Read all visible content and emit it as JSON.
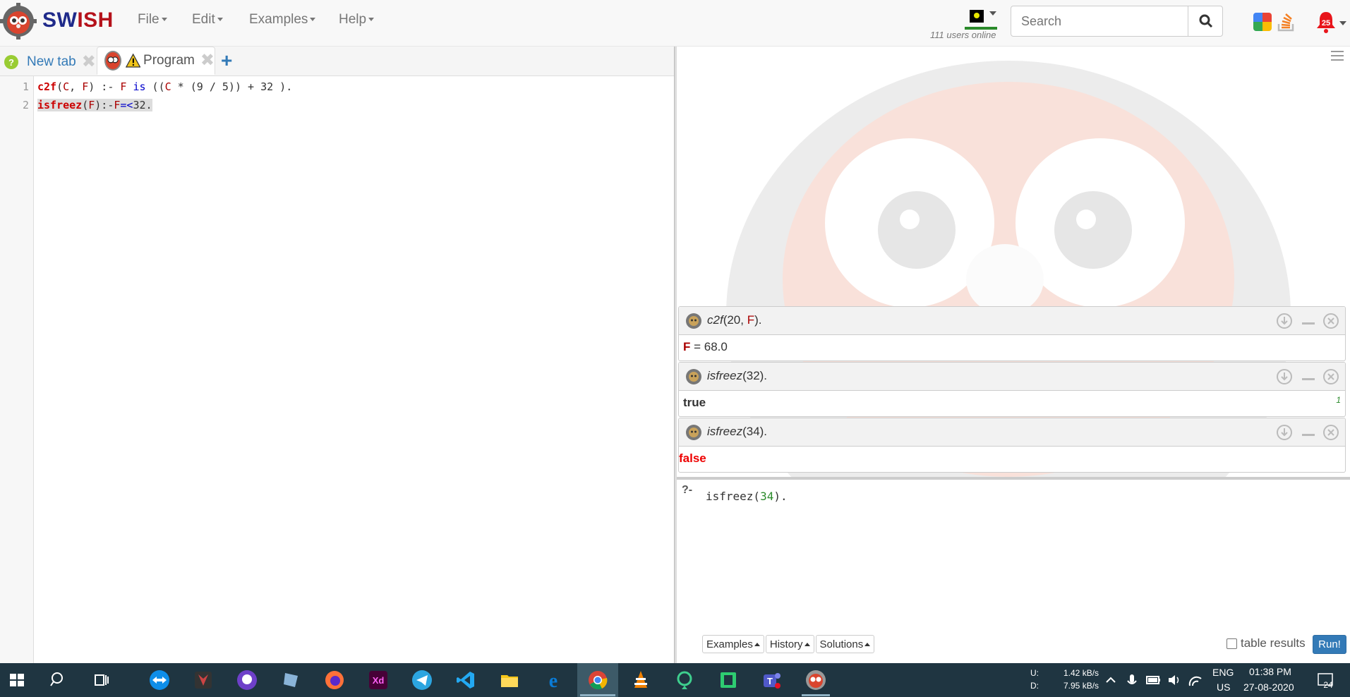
{
  "app": {
    "brand_sw": "SW",
    "brand_ish": "ISH",
    "menu": [
      "File",
      "Edit",
      "Examples",
      "Help"
    ],
    "users_online": "111 users online",
    "search_placeholder": "Search",
    "notification_count": "25"
  },
  "tabs": [
    {
      "label": "New tab"
    },
    {
      "label": "Program"
    }
  ],
  "editor": {
    "line_numbers": [
      "1",
      "2"
    ],
    "lines": [
      "c2f(C, F) :- F is ((C * (9 / 5)) + 32 ).",
      "isfreez(F):-F=<32."
    ]
  },
  "queries": [
    {
      "pred": "c2f",
      "args": "(20, ",
      "var": "F",
      "close": ").",
      "answer_var": "F",
      "answer_rest": " = 68.0"
    },
    {
      "pred": "isfreez",
      "args": "(32).",
      "answer": "true",
      "count": "1"
    },
    {
      "pred": "isfreez",
      "args": "(34).",
      "answer": "false"
    }
  ],
  "console": {
    "prompt": "?-",
    "query_pre": "isfreez(",
    "query_num": "34",
    "query_post": ").",
    "buttons": [
      "Examples",
      "History",
      "Solutions"
    ],
    "table_results": "table results",
    "run": "Run!"
  },
  "taskbar": {
    "net_u_label": "U:",
    "net_d_label": "D:",
    "net_u": "1.42 kB/s",
    "net_d": "7.95 kB/s",
    "lang1": "ENG",
    "lang2": "US",
    "time": "01:38 PM",
    "date": "27-08-2020",
    "notif": "24"
  },
  "colors": {
    "brand_blue": "#1f2a8a",
    "brand_red": "#b5121b",
    "run_button": "#337ab7",
    "false": "#e00000",
    "taskbar": "#1f3541"
  }
}
